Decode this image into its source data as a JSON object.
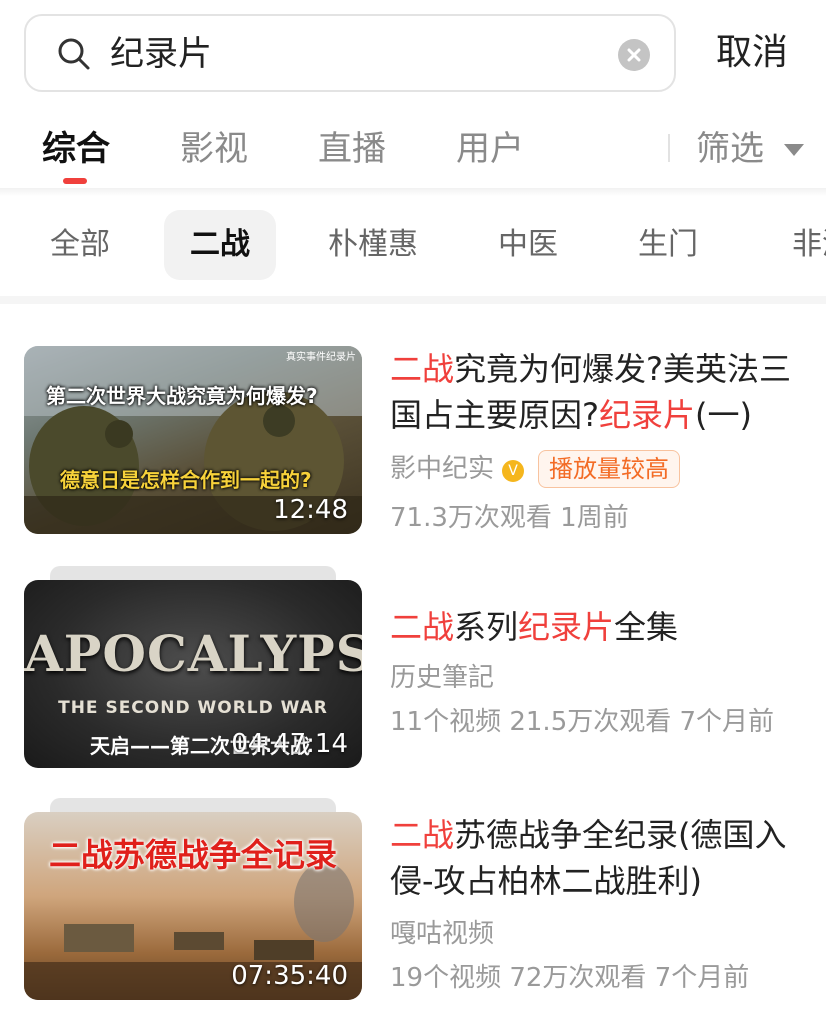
{
  "search": {
    "query": "纪录片",
    "cancel_label": "取消"
  },
  "tabs": {
    "items": [
      "综合",
      "影视",
      "直播",
      "用户"
    ],
    "active": "综合",
    "filter_label": "筛选"
  },
  "chips": {
    "items": [
      "全部",
      "二战",
      "朴槿惠",
      "中医",
      "生门",
      "非洲"
    ],
    "active": "二战"
  },
  "results": [
    {
      "title_parts": [
        "二战",
        "究竟为何爆发?美英法三国占主要原因?",
        "纪录片",
        "(一)"
      ],
      "author": "影中纪实",
      "verified": true,
      "badge": "播放量较高",
      "stats": "71.3万次观看 1周前",
      "duration": "12:48",
      "thumb_text_top": "第二次世界大战究竟为何爆发?",
      "thumb_text_mid": "德意日是怎样合作到一起的?",
      "thumb_text_corner": "真实事件纪录片"
    },
    {
      "title_parts": [
        "二战",
        "系列",
        "纪录片",
        "全集"
      ],
      "author": "历史筆記",
      "stats": "11个视频 21.5万次观看 7个月前",
      "duration": "04:47:14",
      "thumb_text_big": "APOCALYPSE",
      "thumb_text_sub": "THE SECOND WORLD WAR",
      "thumb_text_cn": "天启——第二次世界大战"
    },
    {
      "title_parts": [
        "二战",
        "苏德战争全纪录(德国入侵-攻占柏林二战胜利)"
      ],
      "author": "嘎咕视频",
      "stats": "19个视频 72万次观看 7个月前",
      "duration": "07:35:40",
      "thumb_text_big": "二战苏德战争全记录"
    }
  ],
  "colors": {
    "accent": "#f0403c",
    "badge": "#f36c26",
    "verified": "#f5b61d"
  }
}
